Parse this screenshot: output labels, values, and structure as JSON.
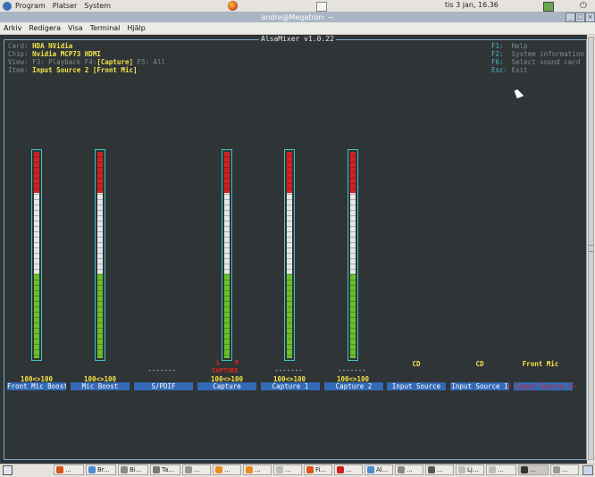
{
  "top_panel": {
    "menus": [
      "Program",
      "Platser",
      "System"
    ],
    "clock": "tis  3 jan, 16.36"
  },
  "window": {
    "title": "andre@Megatron: ~",
    "buttons": [
      "_",
      "□",
      "×"
    ],
    "menu": [
      "Arkiv",
      "Redigera",
      "Visa",
      "Terminal",
      "Hjälp"
    ]
  },
  "mixer": {
    "title": "AlsaMixer v1.0.22",
    "card_label": "Card:",
    "card": "HDA NVidia",
    "chip_label": "Chip:",
    "chip": "Nvidia MCP73 HDMI",
    "view_label": "View:",
    "view_f3": "F3: Playback",
    "view_f4": "F4:",
    "view_capture": "[Capture]",
    "view_f5": "F5: All",
    "item_label": "Item:",
    "item": "Input Source 2 [Front Mic]",
    "help": [
      {
        "key": "F1:",
        "text": "Help"
      },
      {
        "key": "F2:",
        "text": "System information"
      },
      {
        "key": "F6:",
        "text": "Select sound card"
      },
      {
        "key": "Esc:",
        "text": "Exit"
      }
    ],
    "controls": [
      {
        "name": "Front Mic Boost",
        "value": "100<>100",
        "level": 1.0
      },
      {
        "name": "Mic Boost",
        "value": "100<>100",
        "level": 1.0
      },
      {
        "name": "S/PDIF",
        "dashes": "-------"
      },
      {
        "name": "Capture",
        "value": "100<>100",
        "level": 1.0,
        "capture": "CAPTURE",
        "l": "L",
        "r": "R"
      },
      {
        "name": "Capture 1",
        "value": "100<>100",
        "level": 1.0,
        "dashes": "-------"
      },
      {
        "name": "Capture 2",
        "value": "100<>100",
        "level": 1.0,
        "dashes": "-------"
      },
      {
        "name": "Input Source",
        "enum": "CD"
      },
      {
        "name": "Input Source 1",
        "enum": "CD"
      },
      {
        "name": "Input Source 2",
        "enum": "Front Mic",
        "selected": true,
        "lt": "<",
        "gt": ">"
      }
    ]
  },
  "taskbar": {
    "tasks": [
      "Br...",
      "Bi...",
      "Ta...",
      "...",
      "...",
      "...",
      "...",
      "Fi...",
      "...",
      "Al...",
      "...",
      "...",
      "Lj...",
      "...",
      "..."
    ]
  },
  "colors": {
    "terminal_bg": "#2f3436",
    "meter_red": "#d42020",
    "meter_white": "#e6e6e6",
    "meter_green": "#6bbf2a",
    "label_blue": "#3469b5",
    "value_yellow": "#f2e44a"
  }
}
